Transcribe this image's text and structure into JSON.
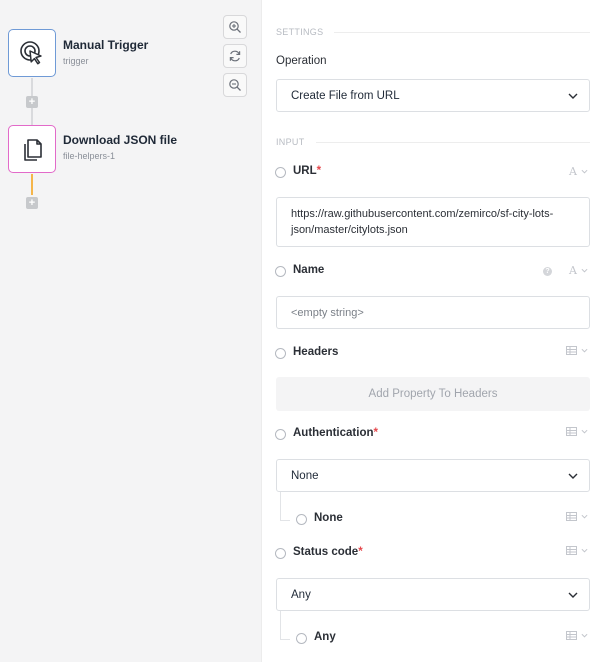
{
  "canvas": {
    "nodes": [
      {
        "title": "Manual Trigger",
        "subtitle": "trigger",
        "icon": "pointer-click-icon",
        "color": "#6f9ad6"
      },
      {
        "title": "Download JSON file",
        "subtitle": "file-helpers-1",
        "icon": "file-copy-icon",
        "color": "#e26ac9"
      }
    ],
    "add_step_label": "+",
    "zoom_controls": [
      "zoom-in-icon",
      "refresh-icon",
      "zoom-out-icon"
    ]
  },
  "settings": {
    "section_label": "SETTINGS",
    "operation_label": "Operation",
    "operation_value": "Create File from URL"
  },
  "input": {
    "section_label": "INPUT",
    "url": {
      "label": "URL",
      "required_mark": "*",
      "type_label": "A",
      "value": "https://raw.githubusercontent.com/zemirco/sf-city-lots-json/master/citylots.json"
    },
    "name": {
      "label": "Name",
      "type_label": "A",
      "help": "?",
      "placeholder": "<empty string>"
    },
    "headers": {
      "label": "Headers",
      "add_label": "Add Property To Headers"
    },
    "authentication": {
      "label": "Authentication",
      "required_mark": "*",
      "value": "None",
      "sub_label": "None"
    },
    "status_code": {
      "label": "Status code",
      "required_mark": "*",
      "value": "Any",
      "sub_label": "Any"
    }
  },
  "colors": {
    "trigger": "#6f9ad6",
    "action": "#e26ac9",
    "connector": "#f5b54a",
    "required": "#e5484d"
  }
}
